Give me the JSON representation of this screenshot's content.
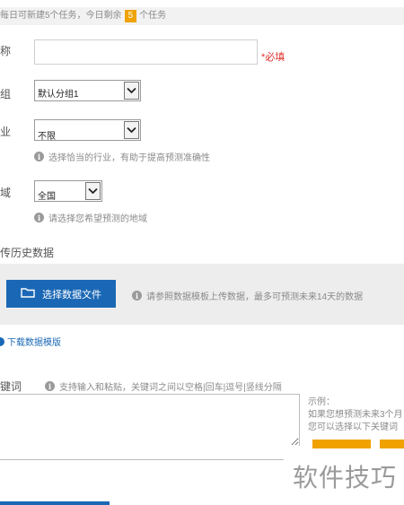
{
  "notice": {
    "prefix": "每日可新建5个任务，今日剩余",
    "remaining": "5",
    "suffix": "个任务"
  },
  "form": {
    "name_label": "称",
    "name_value": "",
    "required_text": "*必填",
    "group_label": "组",
    "group_selected": "默认分组1",
    "industry_label": "业",
    "industry_selected": "不限",
    "industry_hint": "选择恰当的行业，有助于提高预测准确性",
    "region_label": "域",
    "region_selected": "全国",
    "region_hint": "请选择您希望预测的地域"
  },
  "upload": {
    "section_title": "传历史数据",
    "button_label": "选择数据文件",
    "hint": "请参照数据模板上传数据，最多可预测未来14天的数据",
    "download_link": "下载数据模版"
  },
  "keywords": {
    "label": "键词",
    "hint": "支持输入和粘贴，关键词之间以空格|回车|逗号|竖线分隔",
    "value": "",
    "example_title": "示例：",
    "example_line1": "如果您想预测未来3个月",
    "example_line2": "您可以选择以下关键词"
  },
  "watermark": "软件技巧",
  "colors": {
    "accent_blue": "#1a68b5",
    "count_badge": "#f0a200",
    "required_red": "#e0302a"
  },
  "icons": [
    "info-icon",
    "folder-icon",
    "chevron-down-icon"
  ]
}
